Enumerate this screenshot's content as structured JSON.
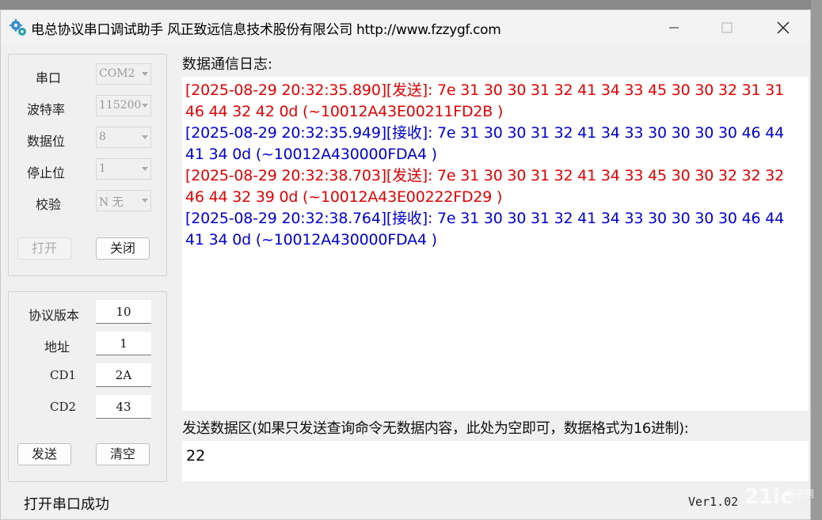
{
  "window": {
    "title": "电总协议串口调试助手 风正致远信息技术股份有限公司 http://www.fzzygf.com",
    "minimize_icon": "minimize-icon",
    "maximize_icon": "maximize-icon",
    "close_icon": "close-icon"
  },
  "serial": {
    "port_label": "串口",
    "port_value": "COM2",
    "baud_label": "波特率",
    "baud_value": "115200",
    "databits_label": "数据位",
    "databits_value": "8",
    "stopbits_label": "停止位",
    "stopbits_value": "1",
    "parity_label": "校验",
    "parity_value": "N 无",
    "open_label": "打开",
    "close_label": "关闭"
  },
  "protocol": {
    "version_label": "协议版本",
    "version_value": "10",
    "addr_label": "地址",
    "addr_value": "1",
    "cd1_label": "CD1",
    "cd1_value": "2A",
    "cd2_label": "CD2",
    "cd2_value": "43",
    "send_label": "发送",
    "clear_label": "清空"
  },
  "log": {
    "label": "数据通信日志:",
    "entries": [
      {
        "type": "sent",
        "text": "[2025-08-29 20:32:35.890][发送]: 7e 31 30 30 31 32 41 34 33 45 30 30 32 31 31 46 44 32 42 0d (~10012A43E00211FD2B )"
      },
      {
        "type": "recv",
        "text": "[2025-08-29 20:32:35.949][接收]: 7e 31 30 30 31 32 41 34 33 30 30 30 30 46 44 41 34 0d (~10012A430000FDA4 )"
      },
      {
        "type": "sent",
        "text": "[2025-08-29 20:32:38.703][发送]: 7e 31 30 30 31 32 41 34 33 45 30 30 32 32 32 46 44 32 39 0d (~10012A43E00222FD29 )"
      },
      {
        "type": "recv",
        "text": "[2025-08-29 20:32:38.764][接收]: 7e 31 30 30 31 32 41 34 33 30 30 30 30 46 44 41 34 0d (~10012A430000FDA4 )"
      }
    ],
    "sent_color": "#e00000",
    "recv_color": "#0000d0"
  },
  "send_area": {
    "label": "发送数据区(如果只发送查询命令无数据内容，此处为空即可，数据格式为16进制):",
    "value": "22"
  },
  "status": {
    "text": "打开串口成功",
    "version": "Ver1.02"
  },
  "watermark": {
    "text": "21ic 电子网"
  }
}
